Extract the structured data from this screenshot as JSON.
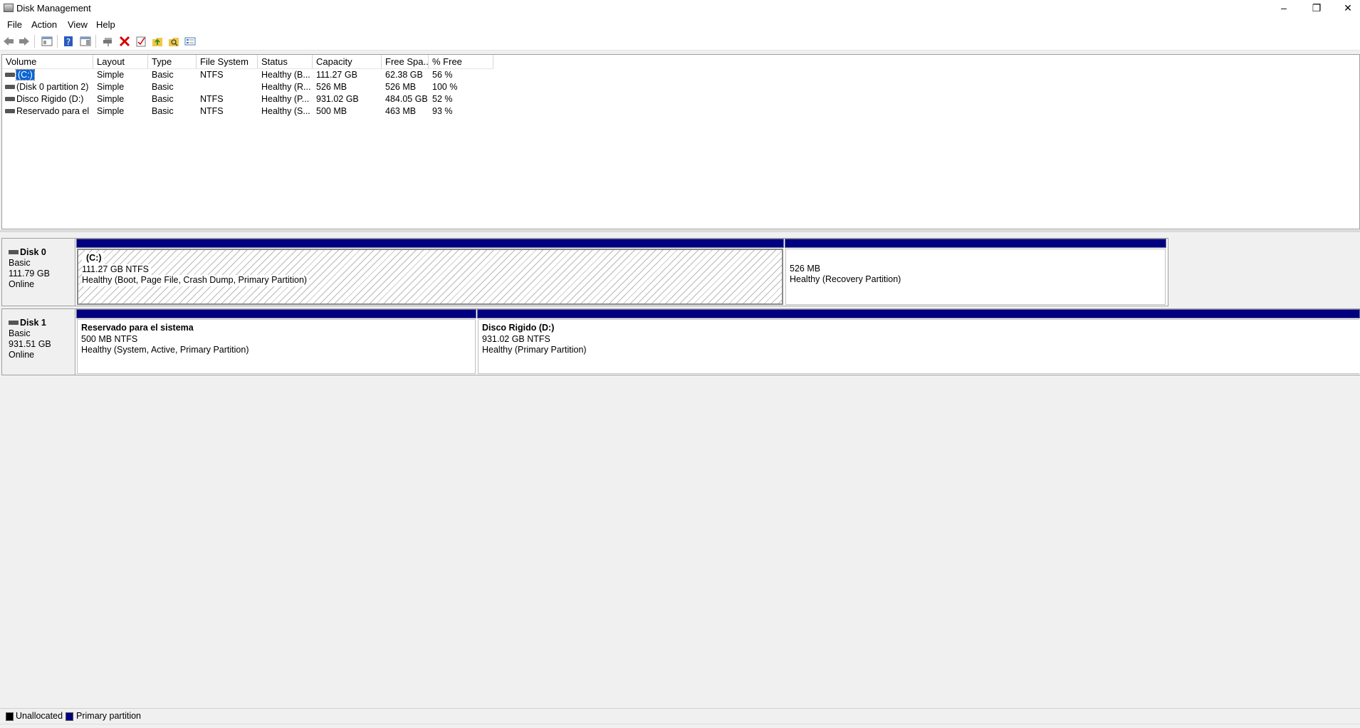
{
  "window": {
    "title": "Disk Management",
    "minimize": "–",
    "restore": "❐",
    "close": "✕"
  },
  "menu": {
    "items": [
      "File",
      "Action",
      "View",
      "Help"
    ]
  },
  "toolbar": {
    "icons": [
      "back-arrow-icon",
      "forward-arrow-icon",
      "console-tree-icon",
      "help-icon",
      "properties-panel-icon",
      "connect-disk-icon",
      "delete-icon",
      "check-icon",
      "folder-up-icon",
      "search-folder-icon",
      "settings-list-icon"
    ],
    "delete_color": "#d40000"
  },
  "list": {
    "columns": [
      "Volume",
      "Layout",
      "Type",
      "File System",
      "Status",
      "Capacity",
      "Free Spa...",
      "% Free"
    ],
    "rows": [
      {
        "volume": "(C:)",
        "layout": "Simple",
        "type": "Basic",
        "fs": "NTFS",
        "status": "Healthy (B...",
        "capacity": "111.27 GB",
        "free": "62.38 GB",
        "pct": "56 %",
        "selected": true
      },
      {
        "volume": "(Disk 0 partition 2)",
        "layout": "Simple",
        "type": "Basic",
        "fs": "",
        "status": "Healthy (R...",
        "capacity": "526 MB",
        "free": "526 MB",
        "pct": "100 %",
        "selected": false
      },
      {
        "volume": "Disco Rigido (D:)",
        "layout": "Simple",
        "type": "Basic",
        "fs": "NTFS",
        "status": "Healthy (P...",
        "capacity": "931.02 GB",
        "free": "484.05 GB",
        "pct": "52 %",
        "selected": false
      },
      {
        "volume": "Reservado para el ...",
        "layout": "Simple",
        "type": "Basic",
        "fs": "NTFS",
        "status": "Healthy (S...",
        "capacity": "500 MB",
        "free": "463 MB",
        "pct": "93 %",
        "selected": false
      }
    ]
  },
  "disks": [
    {
      "name": "Disk 0",
      "type": "Basic",
      "size": "111.79 GB",
      "state": "Online",
      "partitions": [
        {
          "title": "(C:)",
          "size": "111.27 GB NTFS",
          "status": "Healthy (Boot, Page File, Crash Dump, Primary Partition)"
        },
        {
          "title": "",
          "size": "526 MB",
          "status": "Healthy (Recovery Partition)"
        }
      ]
    },
    {
      "name": "Disk 1",
      "type": "Basic",
      "size": "931.51 GB",
      "state": "Online",
      "partitions": [
        {
          "title": "Reservado para el sistema",
          "size": "500 MB NTFS",
          "status": "Healthy (System, Active, Primary Partition)"
        },
        {
          "title": "Disco Rigido  (D:)",
          "size": "931.02 GB NTFS",
          "status": "Healthy (Primary Partition)"
        }
      ]
    }
  ],
  "legend": {
    "items": [
      {
        "label": "Unallocated",
        "color": "#000000"
      },
      {
        "label": "Primary partition",
        "color": "#000080"
      }
    ]
  }
}
